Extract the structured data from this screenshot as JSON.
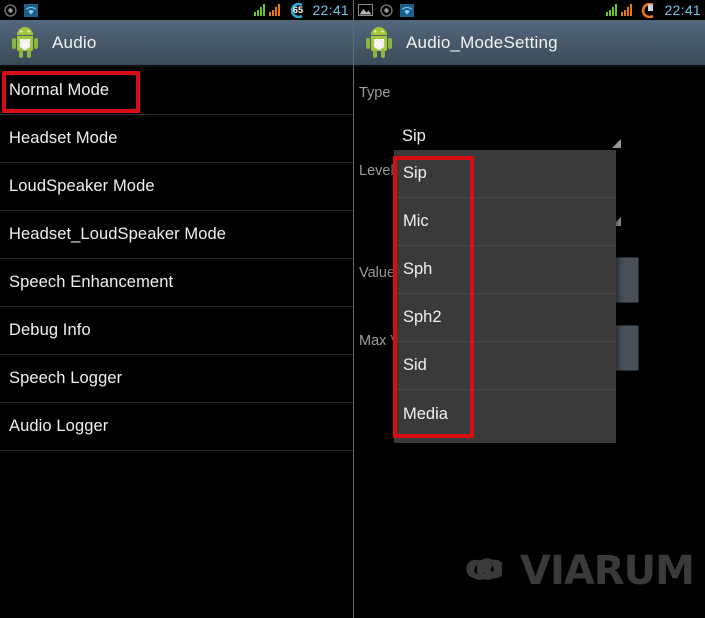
{
  "left_screen": {
    "status_bar": {
      "time": "22:41",
      "battery_percent": "65",
      "icons": [
        "target-circle-icon",
        "wifi-icon",
        "signal-bars-green-icon",
        "signal-bars-orange-icon",
        "battery-icon"
      ]
    },
    "title_bar": {
      "app_icon": "android-robot-icon",
      "title": "Audio"
    },
    "list": {
      "items": [
        {
          "label": "Normal Mode",
          "highlighted": true
        },
        {
          "label": "Headset Mode",
          "highlighted": false
        },
        {
          "label": "LoudSpeaker Mode",
          "highlighted": false
        },
        {
          "label": "Headset_LoudSpeaker Mode",
          "highlighted": false
        },
        {
          "label": "Speech Enhancement",
          "highlighted": false
        },
        {
          "label": "Debug Info",
          "highlighted": false
        },
        {
          "label": "Speech Logger",
          "highlighted": false
        },
        {
          "label": "Audio Logger",
          "highlighted": false
        }
      ]
    }
  },
  "right_screen": {
    "status_bar": {
      "time": "22:41",
      "battery_percent": "",
      "icons": [
        "image-icon",
        "target-circle-icon",
        "wifi-icon",
        "signal-bars-green-icon",
        "signal-bars-orange-icon",
        "battery-icon"
      ]
    },
    "title_bar": {
      "app_icon": "android-robot-icon",
      "title": "Audio_ModeSetting"
    },
    "form": {
      "fields": [
        {
          "label": "Type",
          "value": "Sip"
        },
        {
          "label": "Level",
          "value": ""
        },
        {
          "label": "Value",
          "value": ""
        },
        {
          "label": "Max Vol",
          "value": ""
        }
      ]
    },
    "dropdown": {
      "selected": "Sip",
      "options": [
        "Sip",
        "Mic",
        "Sph",
        "Sph2",
        "Sid",
        "Media"
      ]
    }
  },
  "annotations": {
    "normal_mode_box": "red-highlight-box",
    "dropdown_box": "red-highlight-box",
    "color": "#d80d13"
  },
  "watermark": {
    "text": "VIARUM",
    "logo": "infinity-loop-icon"
  }
}
